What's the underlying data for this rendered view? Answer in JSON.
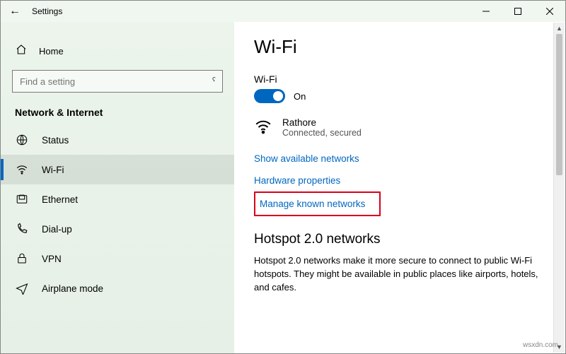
{
  "titlebar": {
    "title": "Settings"
  },
  "sidebar": {
    "home": "Home",
    "search_placeholder": "Find a setting",
    "section": "Network & Internet",
    "items": [
      {
        "label": "Status"
      },
      {
        "label": "Wi-Fi"
      },
      {
        "label": "Ethernet"
      },
      {
        "label": "Dial-up"
      },
      {
        "label": "VPN"
      },
      {
        "label": "Airplane mode"
      }
    ]
  },
  "content": {
    "heading": "Wi-Fi",
    "toggle_section_label": "Wi-Fi",
    "toggle_state": "On",
    "connection": {
      "name": "Rathore",
      "status": "Connected, secured"
    },
    "links": {
      "show_available": "Show available networks",
      "hardware_props": "Hardware properties",
      "manage_known": "Manage known networks"
    },
    "hotspot_heading": "Hotspot 2.0 networks",
    "hotspot_text": "Hotspot 2.0 networks make it more secure to connect to public Wi-Fi hotspots. They might be available in public places like airports, hotels, and cafes."
  },
  "watermark": "wsxdn.com"
}
